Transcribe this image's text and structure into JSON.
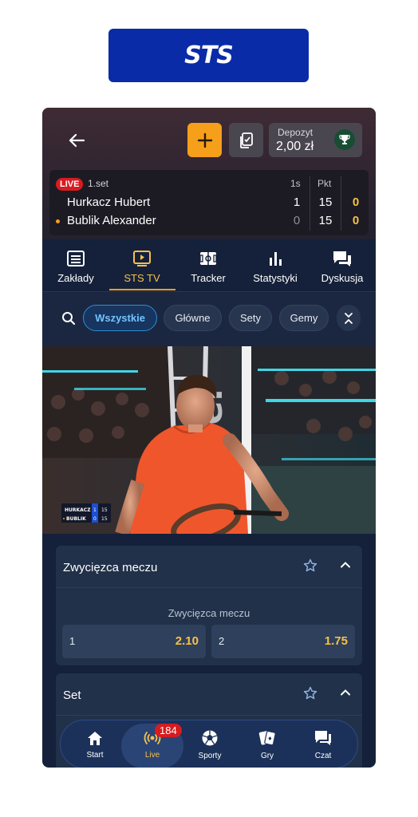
{
  "brand": {
    "logo_text": "STS",
    "banner_color": "#0a2ba8"
  },
  "header": {
    "deposit_label": "Depozyt",
    "deposit_amount": "2,00 zł"
  },
  "scoreboard": {
    "live_label": "LIVE",
    "set_label": "1.set",
    "col_sets": "1s",
    "col_points": "Pkt",
    "players": [
      {
        "name": "Hurkacz Hubert",
        "sets": "1",
        "points": "15",
        "games": "0",
        "serving": false
      },
      {
        "name": "Bublik Alexander",
        "sets": "0",
        "points": "15",
        "games": "0",
        "serving": true
      }
    ]
  },
  "tabs": [
    {
      "label": "Zakłady",
      "icon": "bets-icon",
      "active": false
    },
    {
      "label": "STS TV",
      "icon": "tv-play-icon",
      "active": true
    },
    {
      "label": "Tracker",
      "icon": "tracker-field-icon",
      "active": false
    },
    {
      "label": "Statystyki",
      "icon": "stats-bars-icon",
      "active": false
    },
    {
      "label": "Dyskusja",
      "icon": "chat-bubbles-icon",
      "active": false
    }
  ],
  "filters": {
    "chips": [
      "Wszystkie",
      "Główne",
      "Sety",
      "Gemy"
    ],
    "active": "Wszystkie"
  },
  "video": {
    "overlay": [
      {
        "name": "HURKACZ",
        "sets": "1",
        "points": "15"
      },
      {
        "name": "BUBLIK",
        "sets": "0",
        "points": "15"
      }
    ]
  },
  "markets": [
    {
      "title": "Zwycięzca meczu",
      "subtitle": "Zwycięzca meczu",
      "odds": [
        {
          "label": "1",
          "value": "2.10"
        },
        {
          "label": "2",
          "value": "1.75"
        }
      ]
    },
    {
      "title": "Set"
    }
  ],
  "bottom_nav": {
    "items": [
      {
        "label": "Start",
        "icon": "home-icon"
      },
      {
        "label": "Live",
        "icon": "live-broadcast-icon"
      },
      {
        "label": "Sporty",
        "icon": "soccer-ball-icon"
      },
      {
        "label": "Gry",
        "icon": "cards-icon"
      },
      {
        "label": "Czat",
        "icon": "chat-icon"
      }
    ],
    "active": "Live",
    "live_badge": "184"
  },
  "colors": {
    "accent": "#f59f1b",
    "odds_value": "#f7c04a",
    "live_red": "#d71c20",
    "active_chip": "#2a8fd8"
  }
}
